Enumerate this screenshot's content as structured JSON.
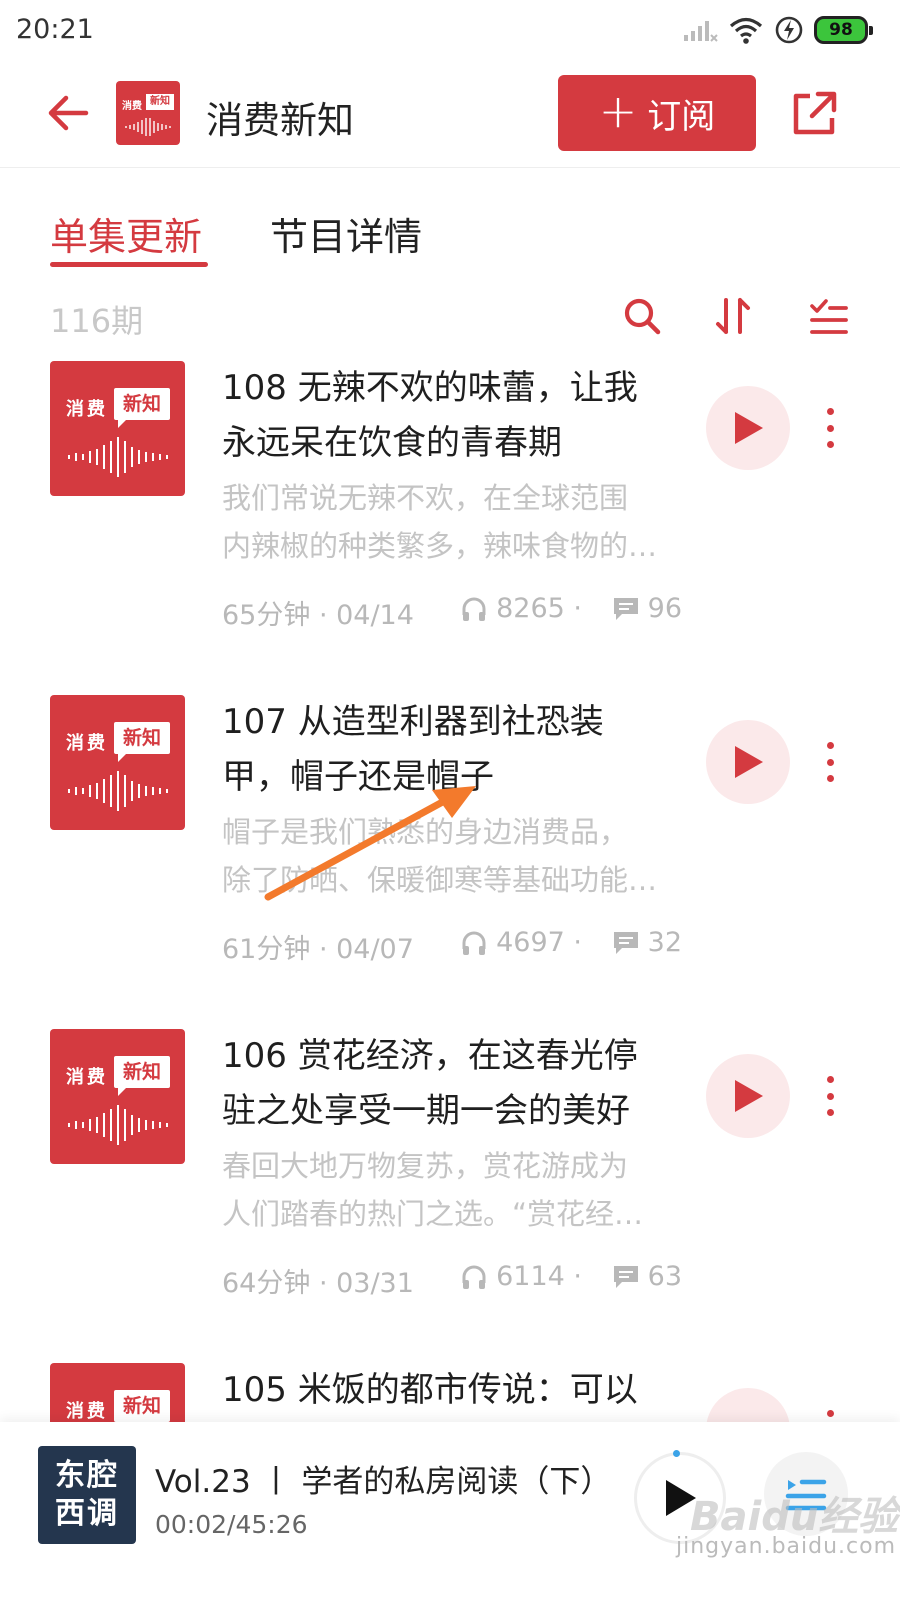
{
  "status_bar": {
    "time": "20:21",
    "battery": "98"
  },
  "header": {
    "title": "消费新知",
    "subscribe_label": "订阅",
    "logo": {
      "main": "消费",
      "bubble": "新知"
    }
  },
  "tabs": [
    {
      "label": "单集更新",
      "active": true
    },
    {
      "label": "节目详情",
      "active": false
    }
  ],
  "list_meta": {
    "count": "116期"
  },
  "cover_art": {
    "main": "消费",
    "bubble": "新知"
  },
  "episodes": [
    {
      "title_line1": "108 无辣不欢的味蕾，让我",
      "title_line2": "永远呆在饮食的青春期",
      "desc_line1": "我们常说无辣不欢，在全球范围",
      "desc_line2": "内辣椒的种类繁多，辣味食物的…",
      "duration_date": "65分钟 · 04/14",
      "plays": "8265 ·",
      "comments": "96"
    },
    {
      "title_line1": "107 从造型利器到社恐装",
      "title_line2": "甲，帽子还是帽子",
      "desc_line1": "帽子是我们熟悉的身边消费品，",
      "desc_line2": "除了防晒、保暖御寒等基础功能…",
      "duration_date": "61分钟 · 04/07",
      "plays": "4697 ·",
      "comments": "32"
    },
    {
      "title_line1": "106 赏花经济，在这春光停",
      "title_line2": "驻之处享受一期一会的美好",
      "desc_line1": "春回大地万物复苏，赏花游成为",
      "desc_line2": "人们踏春的热门之选。“赏花经…",
      "duration_date": "64分钟 · 03/31",
      "plays": "6114 ·",
      "comments": "63"
    },
    {
      "title_line1": "105 米饭的都市传说：可以"
    }
  ],
  "player": {
    "cover_line1": "东腔",
    "cover_line2": "西调",
    "title": "Vol.23 丨 学者的私房阅读（下）",
    "time": "00:02/45:26"
  },
  "watermark": {
    "logo": "Baidu经验",
    "url": "jingyan.baidu.com"
  },
  "colors": {
    "accent": "#d43a40",
    "annotation_arrow": "#f37a2c",
    "player_cover": "#24364e"
  }
}
